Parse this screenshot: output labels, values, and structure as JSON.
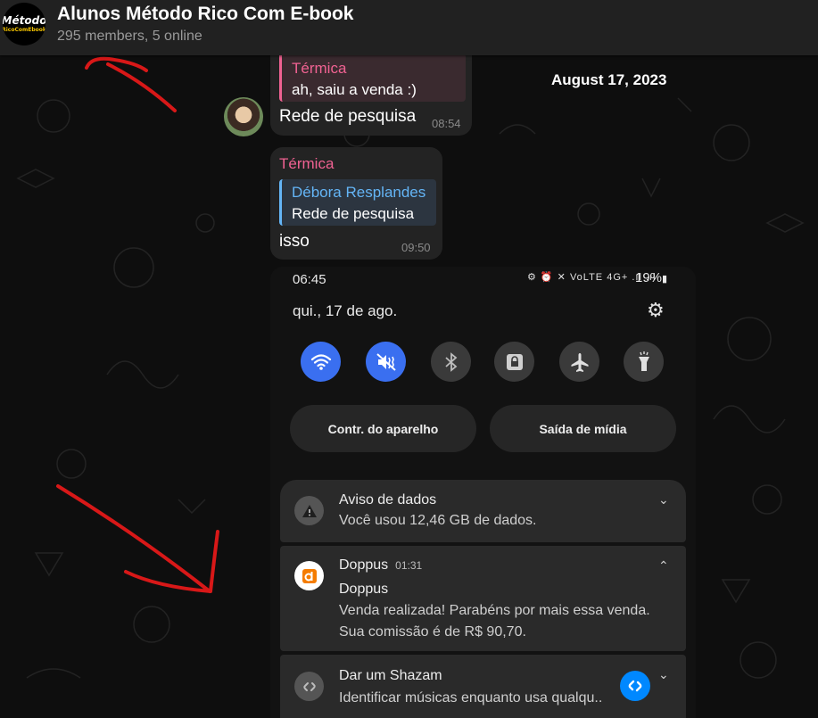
{
  "header": {
    "title": "Alunos Método Rico Com E-book",
    "subtitle": "295 members, 5 online",
    "logo_top": "Método",
    "logo_bottom": "RicoComEbook"
  },
  "date_separator": "August 17, 2023",
  "messages": [
    {
      "sender": "Térmica",
      "quote_text": "ah, saiu a venda :)",
      "text": "Rede de pesquisa",
      "time": "08:54"
    },
    {
      "sender": "Térmica",
      "quote_name": "Débora Resplandes",
      "quote_text": "Rede de pesquisa",
      "text": "isso",
      "time": "09:50"
    }
  ],
  "phone": {
    "time": "06:45",
    "status_icons": "⚙ ⏰ ✕ VoLTE 4G+ .ıl .ıl",
    "battery": "19%",
    "date": "qui., 17 de ago.",
    "quick_settings": [
      {
        "name": "wifi",
        "state": "on"
      },
      {
        "name": "mute",
        "state": "on"
      },
      {
        "name": "bluetooth",
        "state": "off"
      },
      {
        "name": "lock",
        "state": "off"
      },
      {
        "name": "airplane",
        "state": "off"
      },
      {
        "name": "flashlight",
        "state": "off"
      }
    ],
    "buttons": {
      "device_control": "Contr. do aparelho",
      "media_output": "Saída de mídia"
    },
    "notifications": [
      {
        "app": "Aviso de dados",
        "body": "Você usou 12,46 GB de dados."
      },
      {
        "app": "Doppus",
        "time": "01:31",
        "title": "Doppus",
        "body_line1": "Venda realizada! Parabéns por mais essa venda.",
        "body_line2": "Sua comissão é de R$ 90,70."
      },
      {
        "app": "Dar um Shazam",
        "body": "Identificar músicas enquanto usa qualqu.."
      }
    ]
  },
  "colors": {
    "header_bg": "#212121",
    "bubble_bg": "#232323",
    "sender_pink": "#f06292",
    "quote_blue": "#64b5f6",
    "qs_active": "#3a6ff0",
    "annotation_red": "#d81818",
    "doppus_orange": "#f57c00",
    "shazam_blue": "#0088ff"
  }
}
